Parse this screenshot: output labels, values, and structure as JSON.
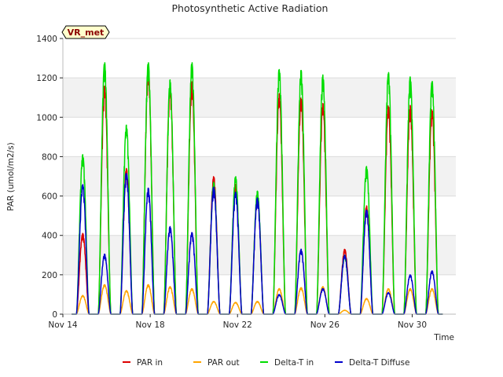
{
  "chart_data": {
    "type": "line",
    "title": "Photosynthetic Active Radiation",
    "xlabel": "Time",
    "ylabel": "PAR (umol/m2/s)",
    "badge": "VR_met",
    "xlim": [
      0,
      18
    ],
    "ylim": [
      0,
      1400
    ],
    "xticks": [
      {
        "day": 0,
        "label": "Nov 14"
      },
      {
        "day": 4,
        "label": "Nov 18"
      },
      {
        "day": 8,
        "label": "Nov 22"
      },
      {
        "day": 12,
        "label": "Nov 26"
      },
      {
        "day": 16,
        "label": "Nov 30"
      }
    ],
    "yticks": [
      0,
      200,
      400,
      600,
      800,
      1000,
      1200,
      1400
    ],
    "grid": true,
    "legend_position": "bottom",
    "days_start": 0.4,
    "series": [
      {
        "name": "PAR in",
        "color": "#dd0000",
        "peaks": [
          410,
          1160,
          740,
          1250,
          1160,
          1180,
          700,
          660,
          610,
          1120,
          1100,
          1070,
          330,
          550,
          1060,
          1060,
          1040
        ]
      },
      {
        "name": "PAR out",
        "color": "#ffa500",
        "peaks": [
          95,
          150,
          120,
          150,
          140,
          130,
          65,
          60,
          65,
          130,
          135,
          140,
          20,
          80,
          130,
          130,
          130
        ]
      },
      {
        "name": "Delta-T in",
        "color": "#00dd00",
        "peaks": [
          810,
          1280,
          960,
          1280,
          1190,
          1280,
          670,
          700,
          625,
          1250,
          1240,
          1215,
          300,
          750,
          1230,
          1205,
          1185
        ]
      },
      {
        "name": "Delta-T Diffuse",
        "color": "#0000cc",
        "peaks": [
          660,
          305,
          720,
          640,
          445,
          415,
          645,
          620,
          590,
          100,
          330,
          130,
          300,
          530,
          110,
          200,
          220
        ]
      }
    ]
  }
}
